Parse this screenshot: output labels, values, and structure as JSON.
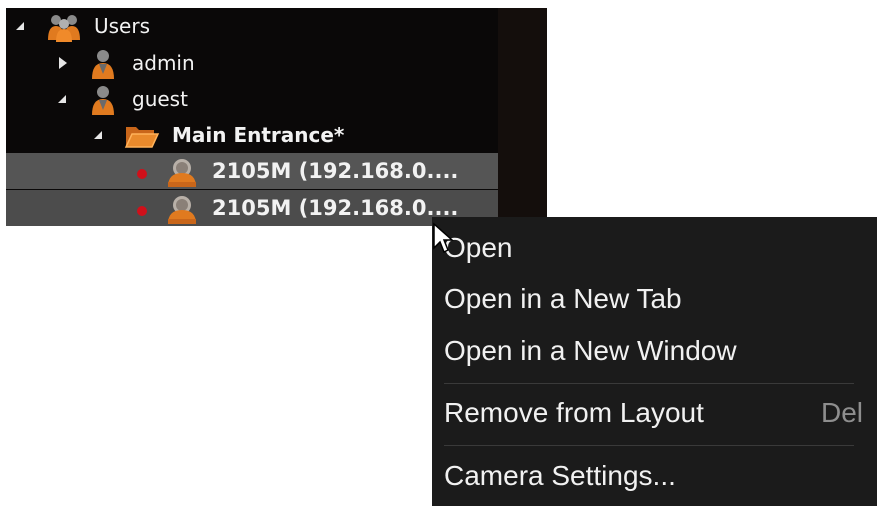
{
  "tree": {
    "root": {
      "label": "Users",
      "icon": "users-group-icon",
      "expanded": true
    },
    "user_admin": {
      "label": "admin",
      "icon": "user-icon",
      "expanded": false
    },
    "user_guest": {
      "label": "guest",
      "icon": "user-icon",
      "expanded": true
    },
    "layout": {
      "label": "Main Entrance*",
      "icon": "folder-open-icon",
      "expanded": true
    },
    "cameras": [
      {
        "label": "2105M (192.168.0....",
        "status": "offline",
        "icon": "camera-icon"
      },
      {
        "label": "2105M (192.168.0....",
        "status": "offline",
        "icon": "camera-icon"
      }
    ]
  },
  "context_menu": {
    "items": [
      {
        "label": "Open",
        "shortcut": ""
      },
      {
        "label": "Open in a New Tab",
        "shortcut": ""
      },
      {
        "label": "Open in a New Window",
        "shortcut": ""
      },
      {
        "label": "Remove from Layout",
        "shortcut": "Del"
      },
      {
        "label": "Camera Settings...",
        "shortcut": ""
      }
    ]
  },
  "colors": {
    "tree_bg": "#0a0808",
    "selection": "#555555",
    "menu_bg": "#1b1b1b",
    "accent_orange": "#e07a1f",
    "status_red": "#d0101a"
  }
}
